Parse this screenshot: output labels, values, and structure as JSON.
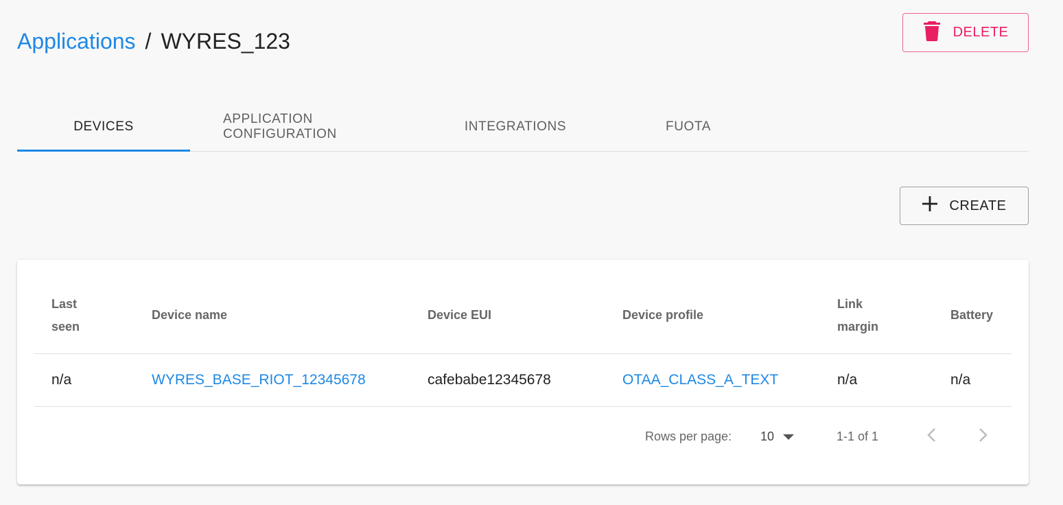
{
  "breadcrumb": {
    "parent": "Applications",
    "separator": "/",
    "current": "WYRES_123"
  },
  "actions": {
    "delete_label": "DELETE",
    "create_label": "CREATE"
  },
  "tabs": [
    {
      "label": "DEVICES",
      "active": true
    },
    {
      "label": "APPLICATION CONFIGURATION",
      "active": false
    },
    {
      "label": "INTEGRATIONS",
      "active": false
    },
    {
      "label": "FUOTA",
      "active": false
    }
  ],
  "table": {
    "columns": [
      {
        "line1": "Last",
        "line2": "seen"
      },
      {
        "line1": "Device name",
        "line2": ""
      },
      {
        "line1": "Device EUI",
        "line2": ""
      },
      {
        "line1": "Device profile",
        "line2": ""
      },
      {
        "line1": "Link",
        "line2": "margin"
      },
      {
        "line1": "Battery",
        "line2": ""
      }
    ],
    "rows": [
      {
        "last_seen": "n/a",
        "device_name": "WYRES_BASE_RIOT_12345678",
        "device_eui": "cafebabe12345678",
        "device_profile": "OTAA_CLASS_A_TEXT",
        "link_margin": "n/a",
        "battery": "n/a"
      }
    ]
  },
  "pagination": {
    "rows_per_page_label": "Rows per page:",
    "rows_per_page_value": "10",
    "range_label": "1-1 of 1"
  },
  "icons": {
    "delete": "trash-icon",
    "create": "plus-icon",
    "dropdown": "caret-down-icon",
    "prev": "chevron-left-icon",
    "next": "chevron-right-icon"
  },
  "colors": {
    "accent": "#1e88e5",
    "danger": "#e91e63",
    "background": "#f8f8f8"
  }
}
